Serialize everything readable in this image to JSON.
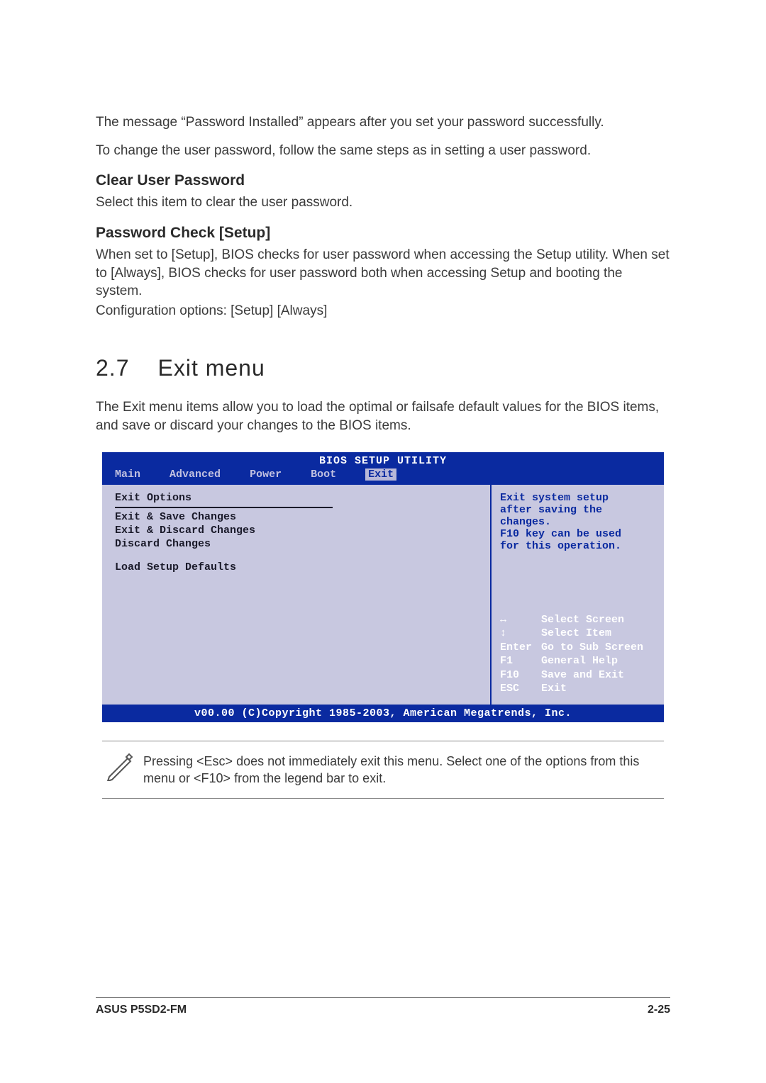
{
  "para1": "The message “Password Installed” appears  after you set your password successfully.",
  "para2": "To change the user password, follow the same steps as in setting a user password.",
  "heading_clear": "Clear User Password",
  "para3": "Select this item to clear the user password.",
  "heading_pwcheck": "Password Check [Setup]",
  "para4": "When set to [Setup], BIOS checks for user password when accessing the Setup utility. When set to [Always], BIOS checks for user password both when accessing Setup and booting the system.",
  "para5": "Configuration options: [Setup] [Always]",
  "section_num": "2.7",
  "section_title": "Exit menu",
  "para6": "The Exit menu items allow you to load the optimal or failsafe default values for the BIOS items, and save or discard your changes to the BIOS items.",
  "bios": {
    "title": "BIOS SETUP UTILITY",
    "tabs": {
      "main": "Main",
      "advanced": "Advanced",
      "power": "Power",
      "boot": "Boot",
      "exit": "Exit"
    },
    "left": {
      "heading": "Exit Options",
      "opt1": "Exit & Save Changes",
      "opt2": "Exit & Discard Changes",
      "opt3": "Discard Changes",
      "opt4": "Load Setup Defaults"
    },
    "help_l1": "Exit system setup",
    "help_l2": "after saving the",
    "help_l3": "changes.",
    "help_l4": "F10 key can be used",
    "help_l5": "for this operation.",
    "legend": {
      "k1": "↔",
      "d1": "Select Screen",
      "k2": "↕",
      "d2": "Select Item",
      "k3": "Enter",
      "d3": "Go to Sub Screen",
      "k4": "F1",
      "d4": "General Help",
      "k5": "F10",
      "d5": "Save and Exit",
      "k6": "ESC",
      "d6": "Exit"
    },
    "footer": "v00.00 (C)Copyright 1985-2003, American Megatrends, Inc."
  },
  "note_text": "Pressing <Esc> does not immediately exit this menu. Select one of the options from this menu or <F10> from the legend bar to exit.",
  "footer": {
    "product": "ASUS P5SD2-FM",
    "page": "2-25"
  }
}
